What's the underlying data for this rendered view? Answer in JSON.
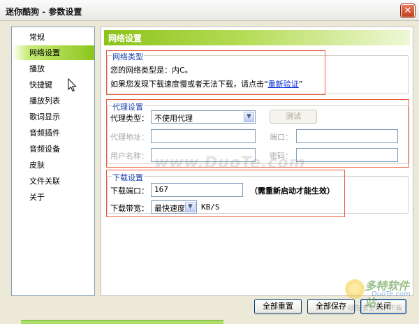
{
  "window": {
    "title": "迷你酷狗 - 参数设置",
    "close_glyph": "✕"
  },
  "sidebar": {
    "items": [
      {
        "label": "常规"
      },
      {
        "label": "网络设置",
        "active": true
      },
      {
        "label": "播放"
      },
      {
        "label": "快捷键"
      },
      {
        "label": "播放列表"
      },
      {
        "label": "歌词显示"
      },
      {
        "label": "音频插件"
      },
      {
        "label": "音频设备"
      },
      {
        "label": "皮肤"
      },
      {
        "label": "文件关联"
      },
      {
        "label": "关于"
      }
    ]
  },
  "panel": {
    "title": "网络设置",
    "network_type": {
      "group_title": "网络类型",
      "status_text": "您的网络类型是：内C。",
      "hint_prefix": "如果您发现下载速度慢或者无法下载，请点击“",
      "link_text": "重新验证",
      "hint_suffix": "”"
    },
    "proxy": {
      "group_title": "代理设置",
      "type_label": "代理类型：",
      "type_value": "不使用代理",
      "test_label": "测试",
      "address_label": "代理地址：",
      "port_label": "端口：",
      "username_label": "用户名称：",
      "password_label": "密码："
    },
    "download": {
      "group_title": "下载设置",
      "port_label": "下载端口：",
      "port_value": "167",
      "port_note": "（需重新启动才能生效）",
      "bandwidth_label": "下载带宽：",
      "bandwidth_value": "最快速度",
      "bandwidth_unit": "KB/S"
    }
  },
  "footer": {
    "reset_all": "全部重置",
    "save_all": "全部保存",
    "close": "关闭"
  },
  "watermark": {
    "text": "www.DuoTe.com",
    "logo_text": "多特软件站",
    "logo_sub": "DuoTe.com",
    "logo_tag": "绿色·安全·软件下载"
  },
  "colors": {
    "accent_green": "#8cc31a",
    "group_title_blue": "#1d44b0",
    "annotation_red": "#ee5a3a",
    "link_blue": "#0a2fd6"
  },
  "icons": {
    "dropdown": "chevron-down-icon",
    "close": "close-icon",
    "cursor": "mouse-pointer-icon"
  }
}
